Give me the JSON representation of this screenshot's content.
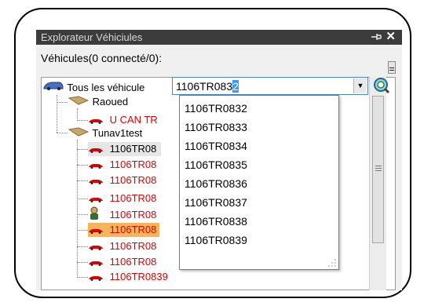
{
  "panel": {
    "title": "Explorateur Véhiciules",
    "pin_glyph": "⊣",
    "close_glyph": "✕",
    "vehicles_label": "Véhicules(0 connecté/0):"
  },
  "tree": {
    "root_label": "Tous les véhicule",
    "groups": [
      {
        "label": "Raoued",
        "children": [
          {
            "label": "U CAN TR",
            "color": "#e00000"
          }
        ]
      },
      {
        "label": "Tunav1test",
        "children": [
          {
            "label": "1106TR08",
            "color": "#000000",
            "state": "selected"
          },
          {
            "label": "1106TR08",
            "color": "#e00000"
          },
          {
            "label": "1106TR08",
            "color": "#e00000"
          },
          {
            "label": "1106TR08",
            "color": "#e00000"
          },
          {
            "label": "1106TR08",
            "color": "#e00000",
            "icon": "person-icon"
          },
          {
            "label": "1106TR08",
            "color": "#e00000",
            "state": "highlighted"
          },
          {
            "label": "1106TR08",
            "color": "#e00000"
          },
          {
            "label": "1106TR08",
            "color": "#e00000"
          },
          {
            "label": "1106TR0839",
            "color": "#e00000"
          }
        ]
      }
    ]
  },
  "search": {
    "value_normal": "1106TR083",
    "value_selected": "2",
    "button_icon": "search-refresh-icon"
  },
  "dropdown": {
    "options": [
      "1106TR0832",
      "1106TR0833",
      "1106TR0834",
      "1106TR0835",
      "1106TR0836",
      "1106TR0837",
      "1106TR0838",
      "1106TR0839"
    ]
  },
  "colors": {
    "offline": "#e00000",
    "highlight": "#f8b45a",
    "accent": "#3399ff"
  }
}
